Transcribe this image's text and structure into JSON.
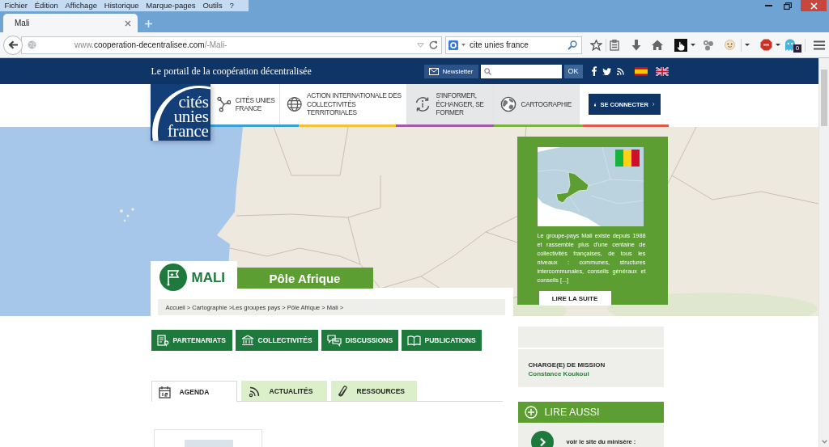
{
  "browser": {
    "menu": [
      "Fichier",
      "Édition",
      "Affichage",
      "Historique",
      "Marque-pages",
      "Outils",
      "?"
    ],
    "tabs": [
      {
        "label": "Mali",
        "selected": true
      }
    ],
    "url": {
      "prefix": "www.",
      "domain": "cooperation-decentralisee.com",
      "path": "/-Mali-"
    },
    "search": {
      "value": "cite unies france"
    },
    "extension_badge": "0"
  },
  "header": {
    "tagline": "Le portail de la coopération décentralisée",
    "newsletter": "Newsletter",
    "search_button": "OK"
  },
  "logo": {
    "lines": [
      "cités",
      "unies",
      "france"
    ]
  },
  "nav": {
    "items": [
      {
        "label": "CITÉS UNIES FRANCE",
        "selected": false
      },
      {
        "label": "ACTION INTERNATIONALE DES COLLECTIVITÉS TERRITORIALES",
        "selected": false
      },
      {
        "label": "S'INFORMER, ÉCHANGER, SE FORMER",
        "selected": true
      },
      {
        "label": "CARTOGRAPHIE",
        "selected": true
      }
    ],
    "login": "SE CONNECTER"
  },
  "map_popup": {
    "text": "Le groupe-pays Mali existe depuis 1988 et rassemble plus d'une centaine de collectivités françaises, de tous les niveaux : communes, structures intercommunales, conseils généraux et conseils [...]",
    "button": "LIRE LA SUITE"
  },
  "country": {
    "name": "MALI",
    "region": "Pôle Afrique",
    "breadcrumb": "Accueil > Cartographie >Les groupes pays > Pôle Afrique > Mali >"
  },
  "sections": [
    "PARTENARIATS",
    "COLLECTIVITÉS",
    "DISCUSSIONS",
    "PUBLICATIONS"
  ],
  "tabs": [
    {
      "label": "AGENDA",
      "selected": true
    },
    {
      "label": "ACTUALITÉS",
      "selected": false
    },
    {
      "label": "RESSOURCES",
      "selected": false
    }
  ],
  "sidebar": {
    "contact_role": "CHARGE(E) DE MISSION",
    "contact_name": "Constance Koukoui",
    "read_also": {
      "title": "LIRE AUSSI",
      "items": [
        "voir le site du minisère :"
      ]
    }
  }
}
